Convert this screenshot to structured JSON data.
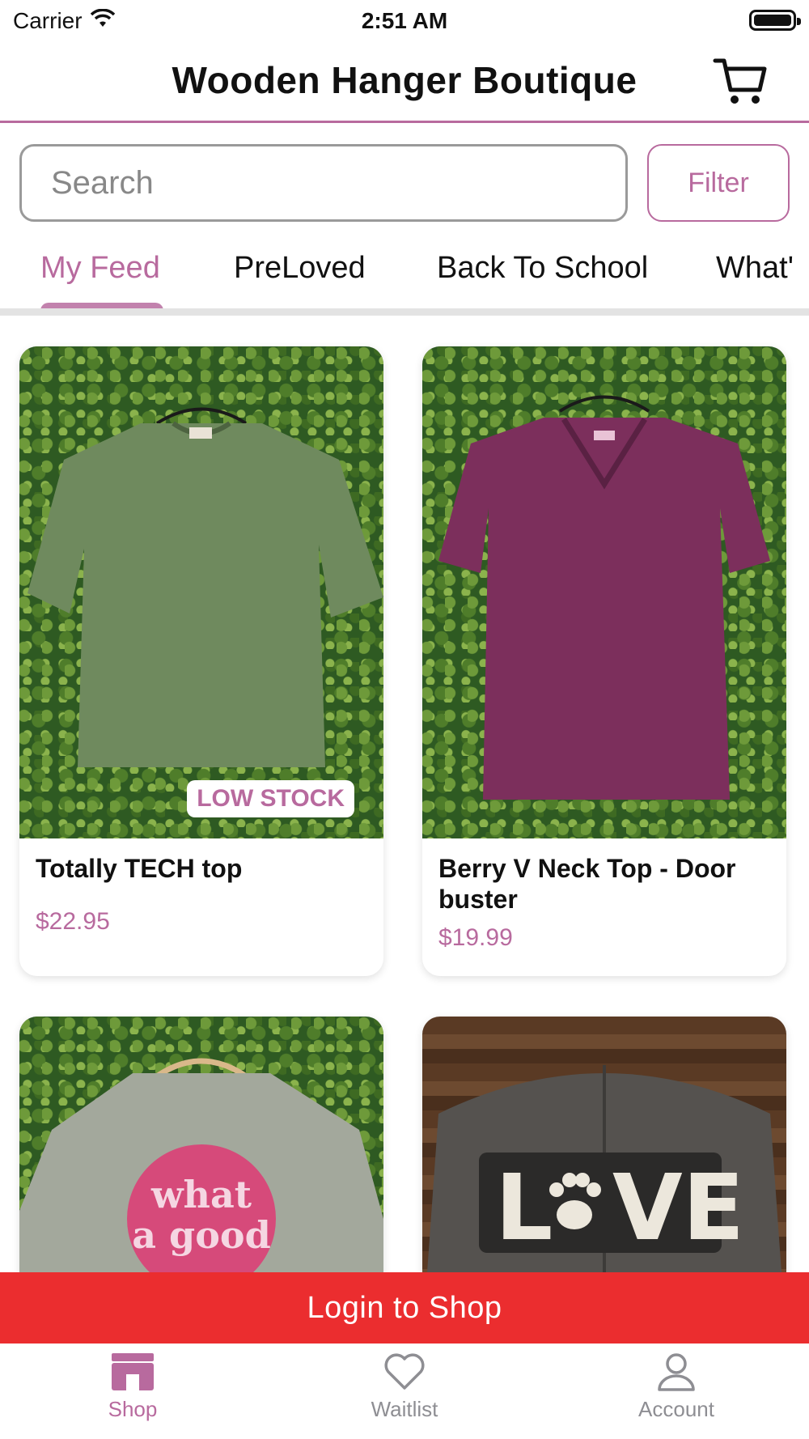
{
  "status_bar": {
    "carrier": "Carrier",
    "time": "2:51 AM"
  },
  "header": {
    "title": "Wooden Hanger Boutique",
    "cart_icon": "cart-icon"
  },
  "search": {
    "placeholder": "Search",
    "filter_label": "Filter"
  },
  "tabs": [
    {
      "label": "My Feed",
      "active": true
    },
    {
      "label": "PreLoved",
      "active": false
    },
    {
      "label": "Back To School",
      "active": false
    },
    {
      "label": "What'",
      "active": false
    }
  ],
  "products": [
    {
      "title": "Totally TECH top",
      "price": "$22.95",
      "badge": "LOW STOCK"
    },
    {
      "title": "Berry V Neck Top - Door buster",
      "price": "$19.99"
    },
    {
      "graphic_text": "what a good day"
    },
    {
      "graphic_text": "LOVE"
    }
  ],
  "login_banner": {
    "label": "Login to Shop"
  },
  "bottom_nav": [
    {
      "label": "Shop",
      "icon": "storefront-icon",
      "active": true
    },
    {
      "label": "Waitlist",
      "icon": "heart-icon",
      "active": false
    },
    {
      "label": "Account",
      "icon": "person-icon",
      "active": false
    }
  ],
  "colors": {
    "accent": "#b86a9e",
    "banner": "#eb2d2f",
    "divider": "#e3e3e3"
  }
}
